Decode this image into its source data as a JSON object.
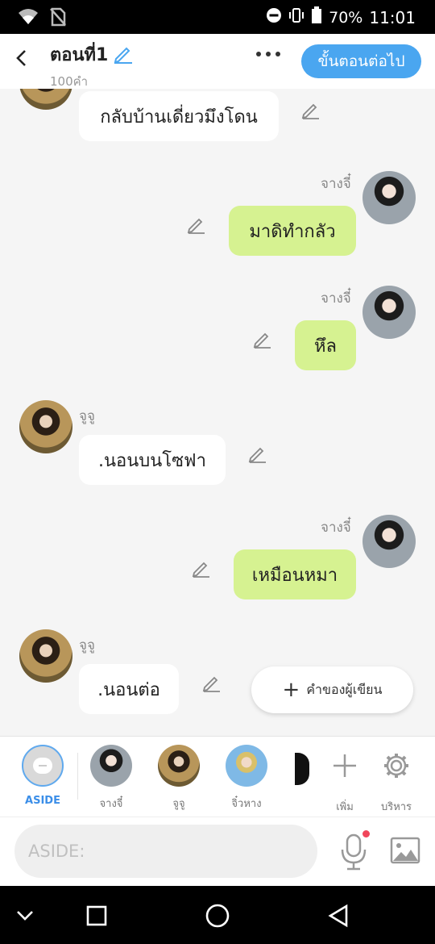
{
  "status_bar": {
    "battery": "70%",
    "time": "11:01"
  },
  "header": {
    "title": "ตอนที่1",
    "word_count": "100คำ",
    "next_button": "ขั้นตอนต่อไป"
  },
  "messages": [
    {
      "side": "left",
      "text": "กลับบ้านเดี่ยวมึงโดน",
      "sender": ""
    },
    {
      "side": "right",
      "text": "มาดิทำกลัว",
      "sender": "จางจี๋"
    },
    {
      "side": "right",
      "text": "หึล",
      "sender": "จางจี๋"
    },
    {
      "side": "left",
      "text": ".นอนบนโซฟา",
      "sender": "จูจู"
    },
    {
      "side": "right",
      "text": "เหมือนหมา",
      "sender": "จางจี๋"
    },
    {
      "side": "left",
      "text": ".นอนต่อ",
      "sender": "จูจู"
    }
  ],
  "author_note_button": "คำของผู้เขียน",
  "characters": [
    {
      "label": "ASIDE"
    },
    {
      "label": "จางจี๋"
    },
    {
      "label": "จูจู"
    },
    {
      "label": "จิ๋วหาง"
    }
  ],
  "char_actions": {
    "add": "เพิ่ม",
    "manage": "บริหาร"
  },
  "input": {
    "placeholder": "ASIDE:"
  },
  "colors": {
    "accent": "#4aa6f0",
    "right_bubble": "#d6f291",
    "left_bubble": "#ffffff",
    "mic_badge": "#f0465b"
  },
  "icons": [
    "wifi-icon",
    "no-sim-icon",
    "dnd-icon",
    "vibrate-icon",
    "battery-icon",
    "back-icon",
    "edit-pencil-icon",
    "more-icon",
    "plus-icon",
    "gear-icon",
    "mic-icon",
    "image-icon",
    "nav-down-icon",
    "nav-square-icon",
    "nav-circle-icon",
    "nav-back-icon"
  ]
}
